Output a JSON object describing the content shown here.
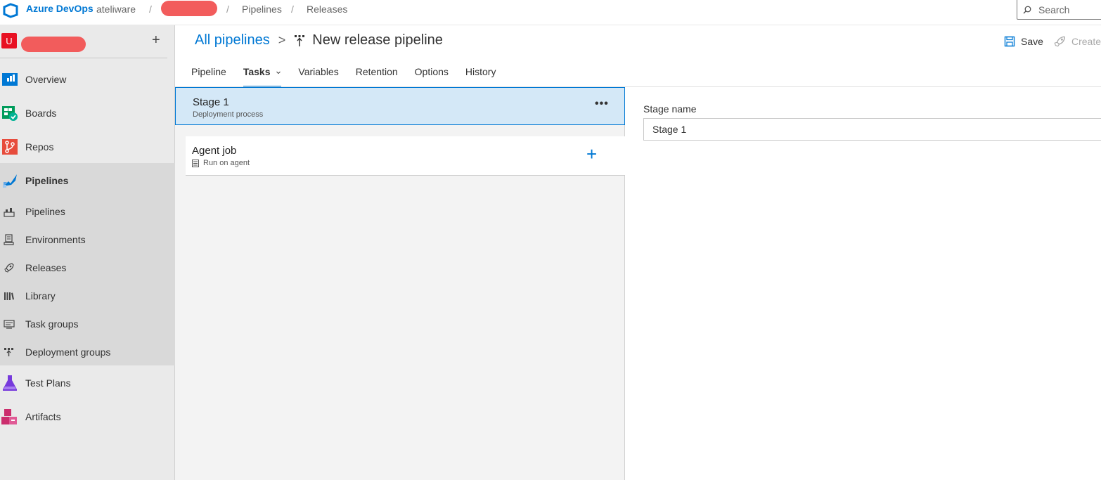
{
  "topbar": {
    "brand": "Azure DevOps",
    "org": "ateliware",
    "sep": "/",
    "crumbs": [
      "Pipelines",
      "Releases"
    ],
    "search_placeholder": "Search"
  },
  "sidebar": {
    "avatar_letter": "U",
    "items": [
      {
        "label": "Overview"
      },
      {
        "label": "Boards"
      },
      {
        "label": "Repos"
      },
      {
        "label": "Pipelines"
      }
    ],
    "pipeline_sub": [
      {
        "label": "Pipelines"
      },
      {
        "label": "Environments"
      },
      {
        "label": "Releases"
      },
      {
        "label": "Library"
      },
      {
        "label": "Task groups"
      },
      {
        "label": "Deployment groups"
      }
    ],
    "bottom_items": [
      {
        "label": "Test Plans"
      },
      {
        "label": "Artifacts"
      }
    ]
  },
  "header": {
    "breadcrumb_link": "All pipelines",
    "chevron": ">",
    "title": "New release pipeline",
    "save_label": "Save",
    "create_label": "Create"
  },
  "tabs": [
    "Pipeline",
    "Tasks",
    "Variables",
    "Retention",
    "Options",
    "History"
  ],
  "stage": {
    "name": "Stage 1",
    "subtitle": "Deployment process",
    "more": "•••"
  },
  "job": {
    "name": "Agent job",
    "subtitle": "Run on agent",
    "add": "+"
  },
  "details": {
    "stage_name_label": "Stage name",
    "stage_name_value": "Stage 1"
  },
  "colors": {
    "accent": "#0078d4",
    "stage_selected_bg": "#d4e8f7",
    "avatar": "#e81123"
  }
}
